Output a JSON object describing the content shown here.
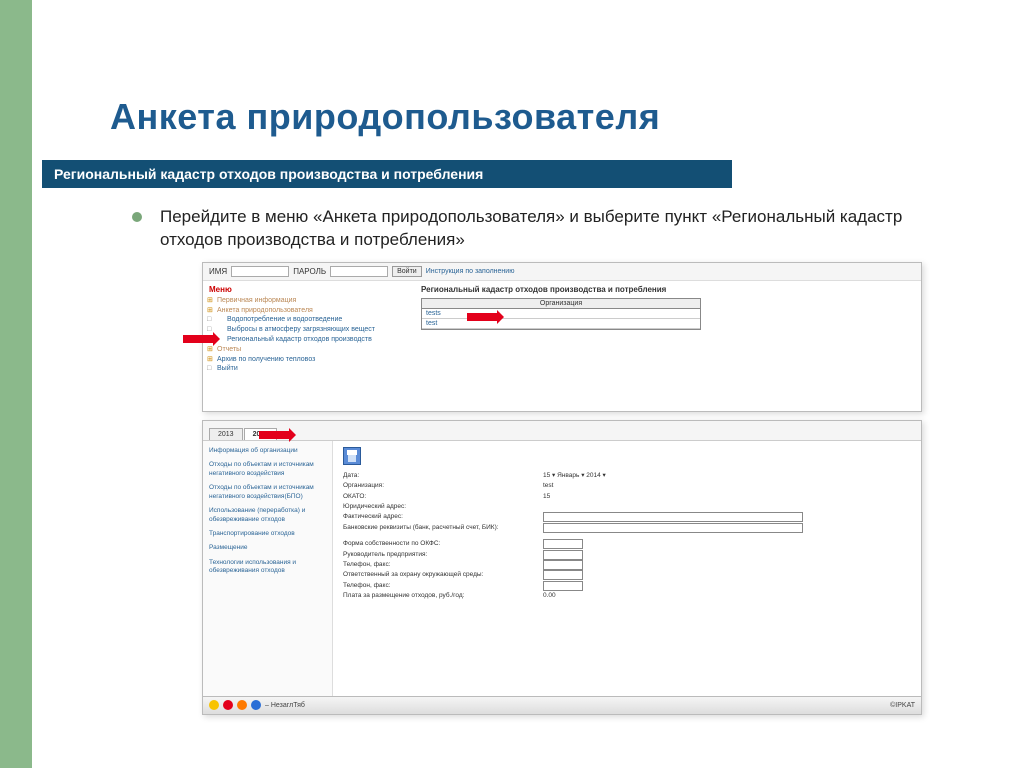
{
  "slide": {
    "title": "Анкета природопользователя",
    "subtitle": "Региональный кадастр отходов производства и потребления",
    "bullet_text": "Перейдите в меню «Анкета природопользователя» и выберите пункт «Региональный кадастр отходов производства и потребления»"
  },
  "login": {
    "name_label": "ИМЯ",
    "pass_label": "ПАРОЛЬ",
    "button": "Войти",
    "help_link": "Инструкция по заполнению"
  },
  "tree": {
    "heading": "Меню",
    "items": [
      "Первичная информация",
      "Анкета природопользователя",
      "Водопотребление и водоотведение",
      "Выбросы в атмосферу загрязняющих вещест",
      "Региональный кадастр отходов производств",
      "Отчеты",
      "Архив по получению тепловоз",
      "Выйти"
    ]
  },
  "cadastre": {
    "title": "Региональный кадастр отходов производства и потребления",
    "org_header": "Организация",
    "rows": [
      "tests",
      "test"
    ]
  },
  "tabs": {
    "t1": "2013",
    "t2": "2013"
  },
  "nav_items": [
    "Информация об организации",
    "Отходы по объектам и источникам негативного воздействия",
    "Отходы по объектам и источникам негативного воздействия(БПО)",
    "Использование (переработка) и обезвреживание отходов",
    "Транспортирование отходов",
    "Размещение",
    "Технологии использования и обезвреживания отходов"
  ],
  "form": {
    "date_label": "Дата:",
    "date_value_day": "15",
    "date_value_month": "Январь",
    "date_value_year": "2014",
    "org_label": "Организация:",
    "org_value": "test",
    "okato_label": "ОКАТО:",
    "okato_value": "15",
    "legal_addr_label": "Юридический адрес:",
    "fact_addr_label": "Фактический адрес:",
    "bank_label": "Банковские реквизиты (банк, расчетный счет, БИК):",
    "ownership_label": "Форма собственности по ОКФС:",
    "head_label": "Руководитель предприятия:",
    "phone_label": "Телефон, факс:",
    "resp_label": "Ответственный за охрану окружающей среды:",
    "phone2_label": "Телефон, факс:",
    "fee_label": "Плата за размещение отходов, руб./год:",
    "fee_value": "0.00"
  },
  "taskbar": {
    "app": "– НезаглТяб",
    "brand": "©IPKAT"
  }
}
